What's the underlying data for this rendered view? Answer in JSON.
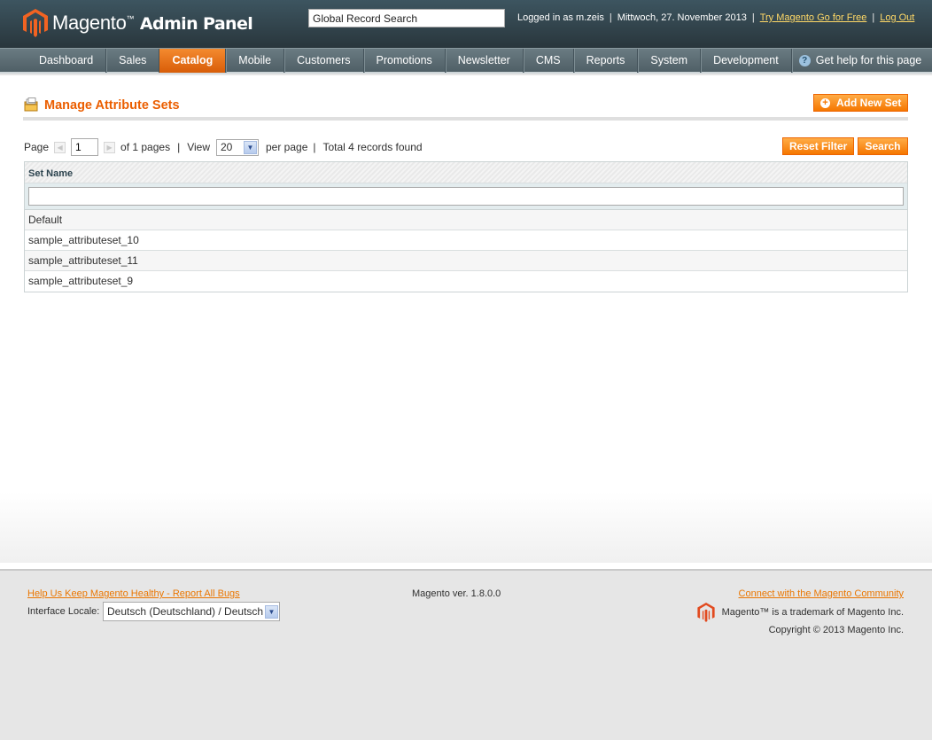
{
  "header": {
    "brand": "Magento",
    "brand_tm": "™",
    "subtitle": "Admin Panel",
    "search_value": "Global Record Search",
    "logged_in": "Logged in as m.zeis",
    "date": "Mittwoch, 27. November 2013",
    "try_link": "Try Magento Go for Free",
    "logout_link": "Log Out",
    "separator": "|"
  },
  "nav": {
    "items": [
      {
        "label": "Dashboard"
      },
      {
        "label": "Sales"
      },
      {
        "label": "Catalog"
      },
      {
        "label": "Mobile"
      },
      {
        "label": "Customers"
      },
      {
        "label": "Promotions"
      },
      {
        "label": "Newsletter"
      },
      {
        "label": "CMS"
      },
      {
        "label": "Reports"
      },
      {
        "label": "System"
      },
      {
        "label": "Development"
      }
    ],
    "active": "Catalog",
    "help_label": "Get help for this page",
    "help_glyph": "?"
  },
  "page": {
    "title": "Manage Attribute Sets",
    "add_button": "Add New Set"
  },
  "pager": {
    "page_label": "Page",
    "page_value": "1",
    "of_pages": "of 1 pages",
    "view_label": "View",
    "view_value": "20",
    "per_page": "per page",
    "total": "Total 4 records found",
    "separator": "|"
  },
  "actions": {
    "reset_filter": "Reset Filter",
    "search": "Search"
  },
  "grid": {
    "column": "Set Name",
    "filter_value": "",
    "rows": [
      "Default",
      "sample_attributeset_10",
      "sample_attributeset_11",
      "sample_attributeset_9"
    ]
  },
  "footer": {
    "bug_link": "Help Us Keep Magento Healthy - Report All Bugs",
    "locale_label": "Interface Locale:",
    "locale_value": "Deutsch (Deutschland) / Deutsch (Deutschland)",
    "version": "Magento ver. 1.8.0.0",
    "community_link": "Connect with the Magento Community",
    "trademark": "Magento™ is a trademark of Magento Inc.",
    "copyright": "Copyright © 2013 Magento Inc."
  },
  "colors": {
    "accent_orange": "#eb5e00",
    "header_bg": "#29363c",
    "link_yellow": "#ffd967"
  },
  "icons": {
    "logo": "magento-logo-icon",
    "title": "folder-attributes-icon",
    "help": "help-icon",
    "add": "plus-circle-icon",
    "prev": "arrow-left-icon",
    "next": "arrow-right-icon",
    "dropdown": "chevron-down-icon"
  }
}
